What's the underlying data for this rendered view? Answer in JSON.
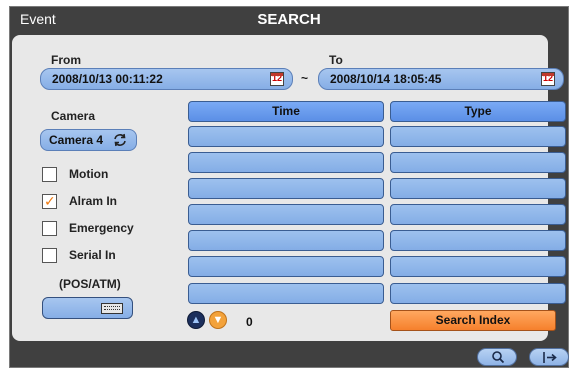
{
  "window": {
    "left_title": "Event",
    "center_title": "SEARCH"
  },
  "from": {
    "label": "From",
    "value": "2008/10/13  00:11:22",
    "icon": "calendar-icon"
  },
  "to": {
    "label": "To",
    "value": "2008/10/14  18:05:45",
    "icon": "calendar-icon"
  },
  "calendar_icon_text": "12",
  "range_separator": "~",
  "camera": {
    "label": "Camera",
    "selected": "Camera 4",
    "icon": "cycle-icon"
  },
  "filters": [
    {
      "label": "Motion",
      "checked": false
    },
    {
      "label": "Alram In",
      "checked": true
    },
    {
      "label": "Emergency",
      "checked": false
    },
    {
      "label": "Serial In",
      "checked": false
    }
  ],
  "pos_atm_label": "(POS/ATM)",
  "keyboard_icon": "keyboard-icon",
  "table": {
    "columns": [
      "Time",
      "Type"
    ],
    "rows": [
      [
        "",
        ""
      ],
      [
        "",
        ""
      ],
      [
        "",
        ""
      ],
      [
        "",
        ""
      ],
      [
        "",
        ""
      ],
      [
        "",
        ""
      ],
      [
        "",
        ""
      ],
      [
        "",
        ""
      ]
    ]
  },
  "pager": {
    "count": "0",
    "up_icon": "chevron-up-icon",
    "down_icon": "chevron-down-icon"
  },
  "search_index_label": "Search Index",
  "bottom_buttons": {
    "search_icon": "search-icon",
    "exit_icon": "exit-icon"
  },
  "colors": {
    "accent_blue": "#86aee6",
    "header_blue": "#5b8fe6",
    "orange": "#f6802c",
    "frame": "#404040"
  }
}
